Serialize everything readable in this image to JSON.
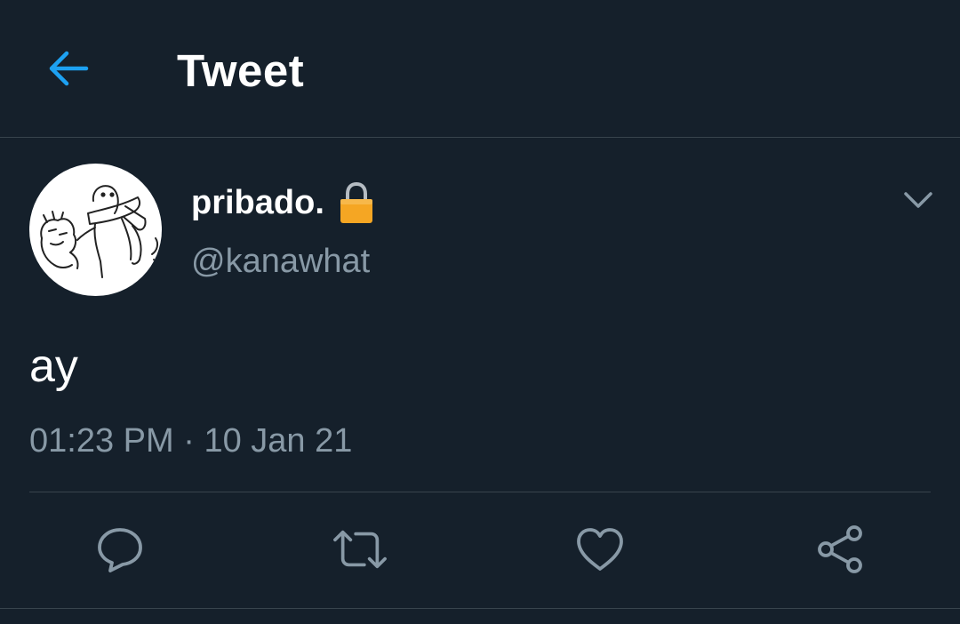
{
  "header": {
    "back_icon": "arrow-left-icon",
    "title": "Tweet"
  },
  "author": {
    "avatar_icon": "avatar-illustration",
    "display_name": "pribado.",
    "protected_icon": "lock-icon",
    "handle": "@kanawhat",
    "menu_icon": "chevron-down-icon"
  },
  "tweet": {
    "text": "ay",
    "time": "01:23 PM",
    "separator": "·",
    "date": "10 Jan 21"
  },
  "actions": [
    {
      "name": "reply",
      "icon": "reply-icon"
    },
    {
      "name": "retweet",
      "icon": "retweet-icon"
    },
    {
      "name": "like",
      "icon": "heart-icon"
    },
    {
      "name": "share",
      "icon": "share-icon"
    }
  ],
  "colors": {
    "background": "#15202b",
    "accent": "#1da1f2",
    "secondary_text": "#8899a6",
    "divider": "#38444d",
    "lock": "#f5a623"
  }
}
